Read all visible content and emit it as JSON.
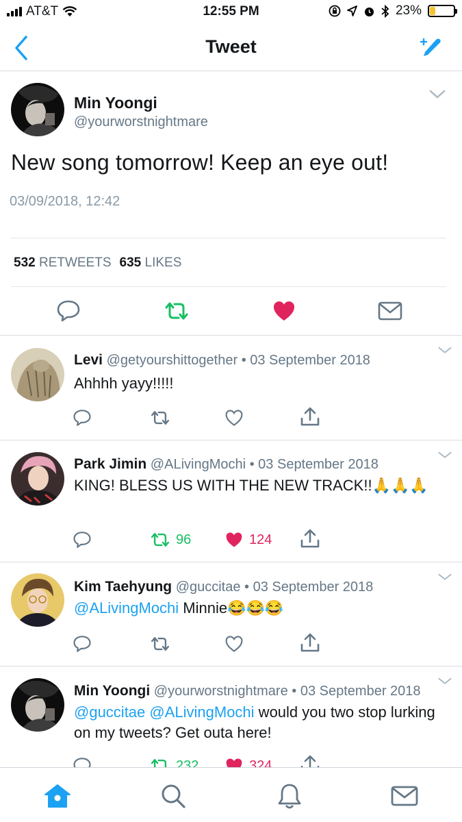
{
  "status_bar": {
    "carrier": "AT&T",
    "time": "12:55 PM",
    "battery": "23%",
    "battery_level": 0.23
  },
  "nav": {
    "title": "Tweet"
  },
  "main_tweet": {
    "name": "Min Yoongi",
    "handle": "@yourworstnightmare",
    "text": "New song tomorrow! Keep an eye out!",
    "date": "03/09/2018, 12:42",
    "retweets_count": "532",
    "retweets_label": "RETWEETS",
    "likes_count": "635",
    "likes_label": "LIKES"
  },
  "replies": [
    {
      "name": "Levi",
      "handle": "@getyourshittogether",
      "date": "03 September 2018",
      "text": "Ahhhh yayy!!!!!",
      "retweets": "",
      "likes": ""
    },
    {
      "name": "Park Jimin",
      "handle": "@ALivingMochi",
      "date": "03 September 2018",
      "text": "KING! BLESS US WITH THE NEW TRACK!!🙏🙏🙏",
      "retweets": "96",
      "likes": "124"
    },
    {
      "name": "Kim Taehyung",
      "handle": "@guccitae",
      "date": "03 September 2018",
      "mention": "@ALivingMochi",
      "text": " Minnie😂😂😂",
      "retweets": "",
      "likes": ""
    },
    {
      "name": "Min Yoongi",
      "handle": "@yourworstnightmare",
      "date": "03 September 2018",
      "mention": "@guccitae @ALivingMochi",
      "text": " would you two stop lurking on my tweets? Get outa here!",
      "retweets": "232",
      "likes": "324"
    }
  ],
  "colors": {
    "accent": "#1da1f2",
    "retweet": "#17bf63",
    "like": "#e0245e",
    "muted": "#657786"
  }
}
